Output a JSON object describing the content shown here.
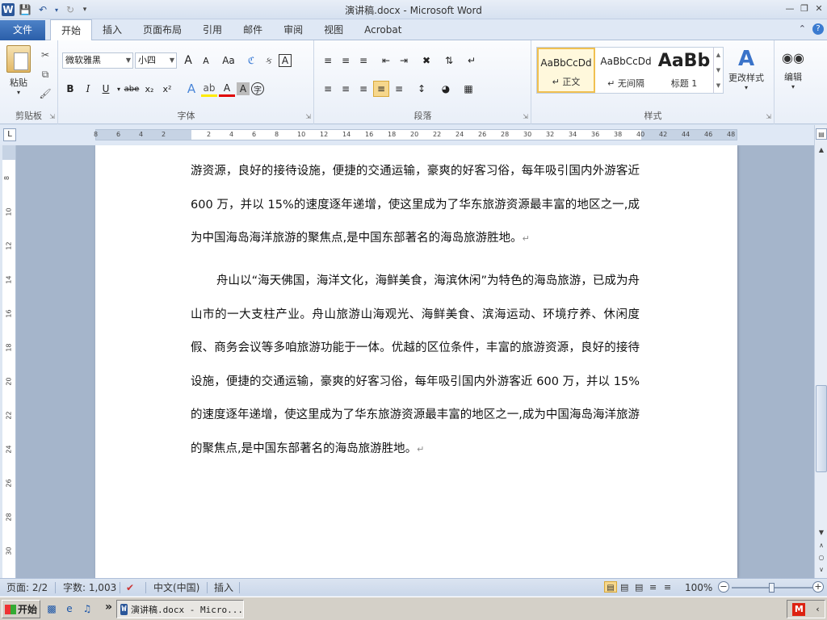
{
  "window": {
    "title": "演讲稿.docx - Microsoft Word",
    "app_icon": "W"
  },
  "ribbon_tabs": {
    "file": "文件",
    "tabs": [
      "开始",
      "插入",
      "页面布局",
      "引用",
      "邮件",
      "审阅",
      "视图",
      "Acrobat"
    ],
    "active": "开始"
  },
  "clipboard": {
    "paste_label": "粘贴",
    "group_label": "剪贴板"
  },
  "font": {
    "family": "微软雅黑",
    "size": "小四",
    "bold": "B",
    "italic": "I",
    "underline": "U",
    "strike": "abe",
    "grow": "A",
    "shrink": "A",
    "change_case": "Aa",
    "group_label": "字体"
  },
  "paragraph": {
    "group_label": "段落"
  },
  "styles": {
    "items": [
      {
        "sample": "AaBbCcDd",
        "name": "↵ 正文"
      },
      {
        "sample": "AaBbCcDd",
        "name": "↵ 无间隔"
      },
      {
        "sample": "AaBb",
        "name": "标题 1"
      }
    ],
    "change_styles": "更改样式",
    "group_label": "样式"
  },
  "editing": {
    "label": "编辑"
  },
  "ruler": {
    "h_ticks": [
      "8",
      "6",
      "4",
      "2",
      "",
      "2",
      "4",
      "6",
      "8",
      "10",
      "12",
      "14",
      "16",
      "18",
      "20",
      "22",
      "24",
      "26",
      "28",
      "30",
      "32",
      "34",
      "36",
      "38",
      "40",
      "42",
      "44",
      "46",
      "48"
    ],
    "v_ticks": [
      "8",
      "10",
      "12",
      "14",
      "16",
      "18",
      "20",
      "22",
      "24",
      "26",
      "28",
      "30",
      "32"
    ]
  },
  "document": {
    "paragraphs": [
      "游资源，良好的接待设施，便捷的交通运输，豪爽的好客习俗，每年吸引国内外游客近 600 万，并以 15%的速度逐年递增，使这里成为了华东旅游资源最丰富的地区之一,成为中国海岛海洋旅游的聚焦点,是中国东部著名的海岛旅游胜地。",
      "舟山以“海天佛国，海洋文化，海鲜美食，海滨休闲”为特色的海岛旅游，已成为舟山市的一大支柱产业。舟山旅游山海观光、海鲜美食、滨海运动、环境疗养、休闲度假、商务会议等多咱旅游功能于一体。优越的区位条件，丰富的旅游资源，良好的接待设施，便捷的交通运输，豪爽的好客习俗，每年吸引国内外游客近 600 万，并以 15%的速度逐年递增，使这里成为了华东旅游资源最丰富的地区之一,成为中国海岛海洋旅游的聚焦点,是中国东部著名的海岛旅游胜地。"
    ],
    "para_mark": "↵"
  },
  "statusbar": {
    "page": "页面: 2/2",
    "words": "字数: 1,003",
    "language": "中文(中国)",
    "insert_mode": "插入",
    "zoom": "100%",
    "zoom_fraction": 0.5
  },
  "taskbar": {
    "start": "开始",
    "task_button": "演讲稿.docx - Micro...",
    "chevron": "»"
  }
}
